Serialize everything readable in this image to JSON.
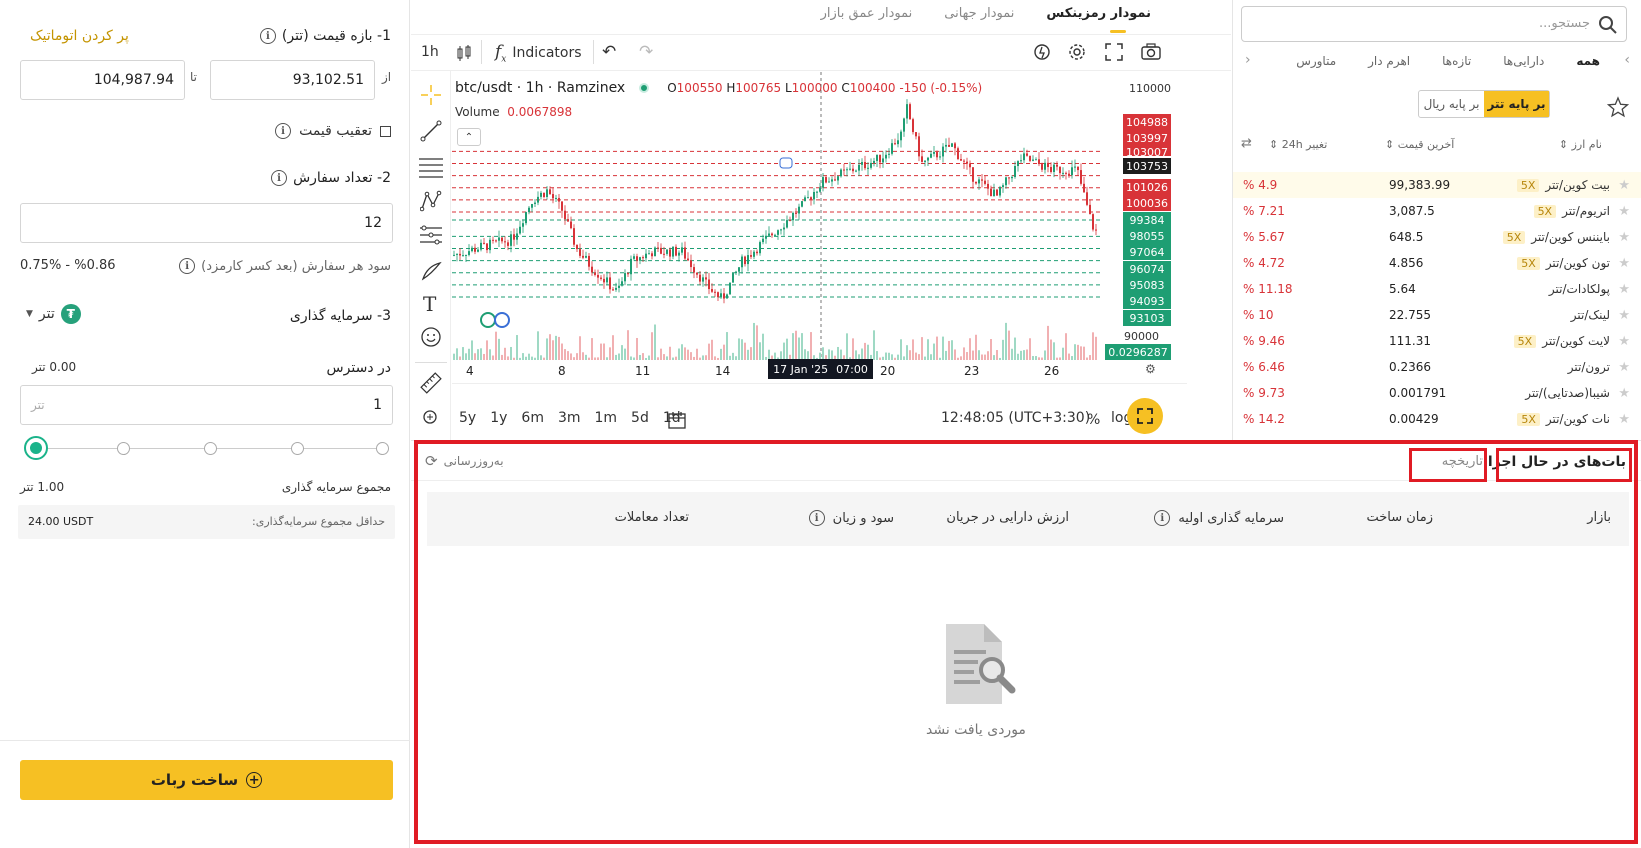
{
  "left": {
    "range_title": "1- بازه قیمت (تتر)",
    "autofill": "پر کردن اتوماتیک",
    "from_label": "از",
    "to_label": "تا",
    "from_value": "93,102.51",
    "to_value": "104,987.94",
    "trailing_label": "تعقیب قیمت",
    "orders_title": "2- تعداد سفارش",
    "orders_value": "12",
    "profit_label": "سود هر سفارش (بعد کسر کارمزد)",
    "profit_value": "0.75%  -  %0.86",
    "invest_title": "3- سرمایه گذاری",
    "currency": "تتر",
    "available_label": "در دسترس",
    "available_value": "0.00 تتر",
    "amount_value": "1",
    "amount_unit": "تتر",
    "total_label": "مجموع سرمایه گذاری",
    "total_value": "1.00 تتر",
    "min_label": "حداقل مجموع سرمایه‌گذاری:",
    "min_value": "24.00 USDT",
    "create_button": "ساخت ربات"
  },
  "chart": {
    "tabs": [
      "نمودار رمزینکس",
      "نمودار جهانی",
      "نمودار عمق بازار"
    ],
    "interval": "1h",
    "indicators": "Indicators",
    "symbol": "btc/usdt · 1h · Ramzinex",
    "open_label": "O",
    "open": "100550",
    "high_label": "H",
    "high": "100765",
    "low_label": "L",
    "low": "100000",
    "close_label": "C",
    "close": "100400",
    "change": "-150 (-0.15%)",
    "volume_label": "Volume",
    "volume_value": "0.0067898",
    "price_top": "110000",
    "price_bottom": "90000",
    "volume_tag": "0.0296287",
    "red_tags": [
      "104988",
      "103997",
      "103007"
    ],
    "current_tag": "103753",
    "red_tags2": [
      "101026",
      "100036"
    ],
    "green_tags": [
      "99384",
      "98055",
      "97064",
      "96074",
      "95083",
      "94093",
      "93103"
    ],
    "x_labels": [
      "4",
      "8",
      "11",
      "14",
      "20",
      "23",
      "26"
    ],
    "crosshair_date": "17 Jan '25",
    "crosshair_time": "07:00",
    "ranges": [
      "5y",
      "1y",
      "6m",
      "3m",
      "1m",
      "5d",
      "1d"
    ],
    "clock": "12:48:05 (UTC+3:30)",
    "pct": "%",
    "log": "log"
  },
  "market": {
    "search_placeholder": "جستجو...",
    "tabs": [
      "همه",
      "دارایی‌ها",
      "تازه‌ها",
      "اهرم دار",
      "متاورس"
    ],
    "base_toggle": [
      "بر پایه تتر",
      "بر پایه ریال"
    ],
    "col_name": "نام ارز",
    "col_price": "آخرین قیمت",
    "col_change": "تغییر 24h",
    "rows": [
      {
        "name": "بیت کوین/تتر",
        "lev": "5X",
        "price": "99,383.99",
        "change": "% 4.9"
      },
      {
        "name": "اتریوم/تتر",
        "lev": "5X",
        "price": "3,087.5",
        "change": "% 7.21"
      },
      {
        "name": "بایننس کوین/تتر",
        "lev": "5X",
        "price": "648.5",
        "change": "% 5.67"
      },
      {
        "name": "تون کوین/تتر",
        "lev": "5X",
        "price": "4.856",
        "change": "% 4.72"
      },
      {
        "name": "پولکادات/تتر",
        "lev": "",
        "price": "5.64",
        "change": "% 11.18"
      },
      {
        "name": "لینک/تتر",
        "lev": "",
        "price": "22.755",
        "change": "% 10"
      },
      {
        "name": "لایت کوین/تتر",
        "lev": "5X",
        "price": "111.31",
        "change": "% 9.46"
      },
      {
        "name": "ترون/تتر",
        "lev": "",
        "price": "0.2366",
        "change": "% 6.46"
      },
      {
        "name": "شیبا(صدتایی)/تتر",
        "lev": "",
        "price": "0.001791",
        "change": "% 9.73"
      },
      {
        "name": "نات کوین/تتر",
        "lev": "5X",
        "price": "0.00429",
        "change": "% 14.2"
      }
    ]
  },
  "bots": {
    "tab_running": "بات‌های در حال اجرا",
    "tab_history": "تاریخچه",
    "refresh": "به‌روزرسانی",
    "columns": [
      "بازار",
      "زمان ساخت",
      "سرمایه گذاری اولیه",
      "ارزش دارایی در جریان",
      "سود و زیان",
      "تعداد معاملات"
    ],
    "empty": "موردی یافت نشد"
  },
  "colors": {
    "accent": "#f6c023",
    "red": "#d83338",
    "green": "#1e9e73",
    "frame": "#e01b24"
  }
}
